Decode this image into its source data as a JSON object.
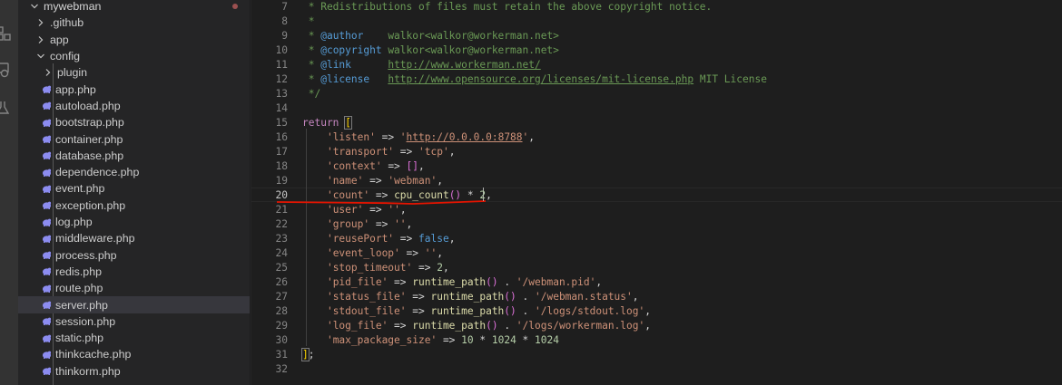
{
  "explorer": {
    "root": "mywebman",
    "items": [
      {
        "label": ".github",
        "type": "folder",
        "level": 1
      },
      {
        "label": "app",
        "type": "folder",
        "level": 1
      },
      {
        "label": "config",
        "type": "folder-open",
        "level": 1
      },
      {
        "label": "plugin",
        "type": "folder",
        "level": 2
      },
      {
        "label": "app.php",
        "type": "php",
        "level": 2
      },
      {
        "label": "autoload.php",
        "type": "php",
        "level": 2
      },
      {
        "label": "bootstrap.php",
        "type": "php",
        "level": 2
      },
      {
        "label": "container.php",
        "type": "php",
        "level": 2
      },
      {
        "label": "database.php",
        "type": "php",
        "level": 2
      },
      {
        "label": "dependence.php",
        "type": "php",
        "level": 2
      },
      {
        "label": "event.php",
        "type": "php",
        "level": 2
      },
      {
        "label": "exception.php",
        "type": "php",
        "level": 2
      },
      {
        "label": "log.php",
        "type": "php",
        "level": 2
      },
      {
        "label": "middleware.php",
        "type": "php",
        "level": 2
      },
      {
        "label": "process.php",
        "type": "php",
        "level": 2
      },
      {
        "label": "redis.php",
        "type": "php",
        "level": 2
      },
      {
        "label": "route.php",
        "type": "php",
        "level": 2
      },
      {
        "label": "server.php",
        "type": "php",
        "level": 2,
        "selected": true
      },
      {
        "label": "session.php",
        "type": "php",
        "level": 2
      },
      {
        "label": "static.php",
        "type": "php",
        "level": 2
      },
      {
        "label": "thinkcache.php",
        "type": "php",
        "level": 2
      },
      {
        "label": "thinkorm.php",
        "type": "php",
        "level": 2
      }
    ]
  },
  "editor": {
    "active_line": "20",
    "line_numbers": [
      "7",
      "8",
      "9",
      "10",
      "11",
      "12",
      "13",
      "14",
      "15",
      "16",
      "17",
      "18",
      "19",
      "20",
      "21",
      "22",
      "23",
      "24",
      "25",
      "26",
      "27",
      "28",
      "29",
      "30",
      "31",
      "32"
    ],
    "lines": [
      {
        "tokens": [
          {
            "t": " * Redistributions of files must retain the above copyright notice.",
            "c": "comment"
          }
        ]
      },
      {
        "tokens": [
          {
            "t": " *",
            "c": "comment"
          }
        ]
      },
      {
        "tokens": [
          {
            "t": " * ",
            "c": "comment"
          },
          {
            "t": "@author",
            "c": "tag"
          },
          {
            "t": "    walkor<walkor@workerman.net>",
            "c": "comment"
          }
        ]
      },
      {
        "tokens": [
          {
            "t": " * ",
            "c": "comment"
          },
          {
            "t": "@copyright",
            "c": "tag"
          },
          {
            "t": " walkor<walkor@workerman.net>",
            "c": "comment"
          }
        ]
      },
      {
        "tokens": [
          {
            "t": " * ",
            "c": "comment"
          },
          {
            "t": "@link",
            "c": "tag"
          },
          {
            "t": "      ",
            "c": "comment"
          },
          {
            "t": "http://www.workerman.net/",
            "c": "link"
          }
        ]
      },
      {
        "tokens": [
          {
            "t": " * ",
            "c": "comment"
          },
          {
            "t": "@license",
            "c": "tag"
          },
          {
            "t": "   ",
            "c": "comment"
          },
          {
            "t": "http://www.opensource.org/licenses/mit-license.php",
            "c": "link"
          },
          {
            "t": " MIT License",
            "c": "comment"
          }
        ]
      },
      {
        "tokens": [
          {
            "t": " */",
            "c": "comment"
          }
        ]
      },
      {
        "tokens": []
      },
      {
        "tokens": [
          {
            "t": "return",
            "c": "kw"
          },
          {
            "t": " ",
            "c": "op"
          },
          {
            "t": "[",
            "c": "bracket-match"
          }
        ]
      },
      {
        "tokens": [
          {
            "t": "    ",
            "c": "op"
          },
          {
            "t": "'listen'",
            "c": "str"
          },
          {
            "t": " => ",
            "c": "op"
          },
          {
            "t": "'",
            "c": "str"
          },
          {
            "t": "http://0.0.0.0:8788",
            "c": "url"
          },
          {
            "t": "'",
            "c": "str"
          },
          {
            "t": ",",
            "c": "op"
          }
        ]
      },
      {
        "tokens": [
          {
            "t": "    ",
            "c": "op"
          },
          {
            "t": "'transport'",
            "c": "str"
          },
          {
            "t": " => ",
            "c": "op"
          },
          {
            "t": "'tcp'",
            "c": "str"
          },
          {
            "t": ",",
            "c": "op"
          }
        ]
      },
      {
        "tokens": [
          {
            "t": "    ",
            "c": "op"
          },
          {
            "t": "'context'",
            "c": "str"
          },
          {
            "t": " => ",
            "c": "op"
          },
          {
            "t": "[]",
            "c": "paren"
          },
          {
            "t": ",",
            "c": "op"
          }
        ]
      },
      {
        "tokens": [
          {
            "t": "    ",
            "c": "op"
          },
          {
            "t": "'name'",
            "c": "str"
          },
          {
            "t": " => ",
            "c": "op"
          },
          {
            "t": "'webman'",
            "c": "str"
          },
          {
            "t": ",",
            "c": "op"
          }
        ]
      },
      {
        "tokens": [
          {
            "t": "    ",
            "c": "op"
          },
          {
            "t": "'count'",
            "c": "str"
          },
          {
            "t": " => ",
            "c": "op"
          },
          {
            "t": "cpu_count",
            "c": "fn"
          },
          {
            "t": "()",
            "c": "paren"
          },
          {
            "t": " * ",
            "c": "op"
          },
          {
            "t": "2",
            "c": "num"
          },
          {
            "t": ",",
            "c": "op"
          }
        ]
      },
      {
        "tokens": [
          {
            "t": "    ",
            "c": "op"
          },
          {
            "t": "'user'",
            "c": "str"
          },
          {
            "t": " => ",
            "c": "op"
          },
          {
            "t": "''",
            "c": "str"
          },
          {
            "t": ",",
            "c": "op"
          }
        ]
      },
      {
        "tokens": [
          {
            "t": "    ",
            "c": "op"
          },
          {
            "t": "'group'",
            "c": "str"
          },
          {
            "t": " => ",
            "c": "op"
          },
          {
            "t": "''",
            "c": "str"
          },
          {
            "t": ",",
            "c": "op"
          }
        ]
      },
      {
        "tokens": [
          {
            "t": "    ",
            "c": "op"
          },
          {
            "t": "'reusePort'",
            "c": "str"
          },
          {
            "t": " => ",
            "c": "op"
          },
          {
            "t": "false",
            "c": "bool"
          },
          {
            "t": ",",
            "c": "op"
          }
        ]
      },
      {
        "tokens": [
          {
            "t": "    ",
            "c": "op"
          },
          {
            "t": "'event_loop'",
            "c": "str"
          },
          {
            "t": " => ",
            "c": "op"
          },
          {
            "t": "''",
            "c": "str"
          },
          {
            "t": ",",
            "c": "op"
          }
        ]
      },
      {
        "tokens": [
          {
            "t": "    ",
            "c": "op"
          },
          {
            "t": "'stop_timeout'",
            "c": "str"
          },
          {
            "t": " => ",
            "c": "op"
          },
          {
            "t": "2",
            "c": "num"
          },
          {
            "t": ",",
            "c": "op"
          }
        ]
      },
      {
        "tokens": [
          {
            "t": "    ",
            "c": "op"
          },
          {
            "t": "'pid_file'",
            "c": "str"
          },
          {
            "t": " => ",
            "c": "op"
          },
          {
            "t": "runtime_path",
            "c": "fn"
          },
          {
            "t": "()",
            "c": "paren"
          },
          {
            "t": " . ",
            "c": "op"
          },
          {
            "t": "'/webman.pid'",
            "c": "str"
          },
          {
            "t": ",",
            "c": "op"
          }
        ]
      },
      {
        "tokens": [
          {
            "t": "    ",
            "c": "op"
          },
          {
            "t": "'status_file'",
            "c": "str"
          },
          {
            "t": " => ",
            "c": "op"
          },
          {
            "t": "runtime_path",
            "c": "fn"
          },
          {
            "t": "()",
            "c": "paren"
          },
          {
            "t": " . ",
            "c": "op"
          },
          {
            "t": "'/webman.status'",
            "c": "str"
          },
          {
            "t": ",",
            "c": "op"
          }
        ]
      },
      {
        "tokens": [
          {
            "t": "    ",
            "c": "op"
          },
          {
            "t": "'stdout_file'",
            "c": "str"
          },
          {
            "t": " => ",
            "c": "op"
          },
          {
            "t": "runtime_path",
            "c": "fn"
          },
          {
            "t": "()",
            "c": "paren"
          },
          {
            "t": " . ",
            "c": "op"
          },
          {
            "t": "'/logs/stdout.log'",
            "c": "str"
          },
          {
            "t": ",",
            "c": "op"
          }
        ]
      },
      {
        "tokens": [
          {
            "t": "    ",
            "c": "op"
          },
          {
            "t": "'log_file'",
            "c": "str"
          },
          {
            "t": " => ",
            "c": "op"
          },
          {
            "t": "runtime_path",
            "c": "fn"
          },
          {
            "t": "()",
            "c": "paren"
          },
          {
            "t": " . ",
            "c": "op"
          },
          {
            "t": "'/logs/workerman.log'",
            "c": "str"
          },
          {
            "t": ",",
            "c": "op"
          }
        ]
      },
      {
        "tokens": [
          {
            "t": "    ",
            "c": "op"
          },
          {
            "t": "'max_package_size'",
            "c": "str"
          },
          {
            "t": " => ",
            "c": "op"
          },
          {
            "t": "10",
            "c": "num"
          },
          {
            "t": " * ",
            "c": "op"
          },
          {
            "t": "1024",
            "c": "num"
          },
          {
            "t": " * ",
            "c": "op"
          },
          {
            "t": "1024",
            "c": "num"
          }
        ]
      },
      {
        "tokens": [
          {
            "t": "]",
            "c": "bracket-match"
          },
          {
            "t": ";",
            "c": "op"
          }
        ]
      },
      {
        "tokens": []
      }
    ]
  },
  "colors": {
    "annotation_underline": "#e51400",
    "editor_bg": "#1e1e1e",
    "sidebar_bg": "#252526"
  }
}
